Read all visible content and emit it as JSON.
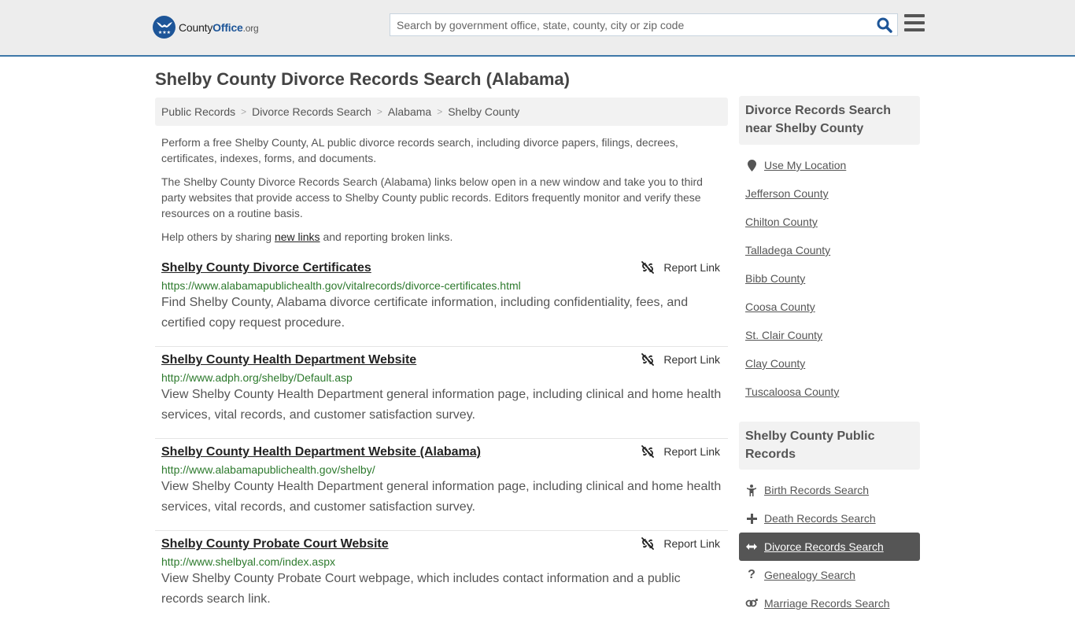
{
  "header": {
    "logo": {
      "name_part1": "County",
      "name_part2": "Office",
      "name_suffix": ".org"
    },
    "search": {
      "placeholder": "Search by government office, state, county, city or zip code",
      "value": ""
    },
    "colors": {
      "brand": "#1d5598",
      "header_border": "#3e78a8",
      "url_green": "#2d7a2d",
      "active_sidebar": "#555555"
    }
  },
  "main": {
    "title": "Shelby County Divorce Records Search (Alabama)",
    "breadcrumb": [
      "Public Records",
      "Divorce Records Search",
      "Alabama",
      "Shelby County"
    ],
    "intro": {
      "p1": "Perform a free Shelby County, AL public divorce records search, including divorce papers, filings, decrees, certificates, indexes, forms, and documents.",
      "p2": "The Shelby County Divorce Records Search (Alabama) links below open in a new window and take you to third party websites that provide access to Shelby County public records. Editors frequently monitor and verify these resources on a routine basis.",
      "p3_before": "Help others by sharing ",
      "p3_link": "new links",
      "p3_after": " and reporting broken links."
    },
    "report_label": "Report Link",
    "results": [
      {
        "title": "Shelby County Divorce Certificates",
        "url": "https://www.alabamapublichealth.gov/vitalrecords/divorce-certificates.html",
        "description": "Find Shelby County, Alabama divorce certificate information, including confidentiality, fees, and certified copy request procedure."
      },
      {
        "title": "Shelby County Health Department Website",
        "url": "http://www.adph.org/shelby/Default.asp",
        "description": "View Shelby County Health Department general information page, including clinical and home health services, vital records, and customer satisfaction survey."
      },
      {
        "title": "Shelby County Health Department Website (Alabama)",
        "url": "http://www.alabamapublichealth.gov/shelby/",
        "description": "View Shelby County Health Department general information page, including clinical and home health services, vital records, and customer satisfaction survey."
      },
      {
        "title": "Shelby County Probate Court Website",
        "url": "http://www.shelbyal.com/index.aspx",
        "description": "View Shelby County Probate Court webpage, which includes contact information and a public records search link."
      }
    ]
  },
  "sidebar": {
    "nearby": {
      "heading": "Divorce Records Search near Shelby County",
      "use_location": "Use My Location",
      "counties": [
        "Jefferson County",
        "Chilton County",
        "Talladega County",
        "Bibb County",
        "Coosa County",
        "St. Clair County",
        "Clay County",
        "Tuscaloosa County"
      ]
    },
    "public_records": {
      "heading": "Shelby County Public Records",
      "items": [
        {
          "label": "Birth Records Search",
          "icon": "child-icon",
          "active": false
        },
        {
          "label": "Death Records Search",
          "icon": "plus-icon",
          "active": false
        },
        {
          "label": "Divorce Records Search",
          "icon": "arrows-h-icon",
          "active": true
        },
        {
          "label": "Genealogy Search",
          "icon": "question-icon",
          "active": false
        },
        {
          "label": "Marriage Records Search",
          "icon": "venus-mars-icon",
          "active": false
        }
      ]
    }
  }
}
